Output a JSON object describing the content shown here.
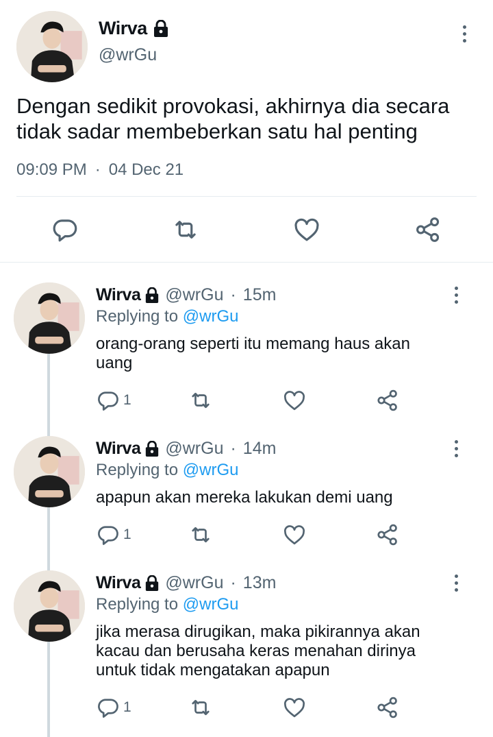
{
  "main_tweet": {
    "name": "Wirva",
    "handle": "@wrGu",
    "text_line1": "Dengan sedikit provokasi, akhirnya dia secara",
    "text_line2": "tidak sadar membeberkan satu hal penting",
    "time": "09:09 PM",
    "separator": "·",
    "date": "04 Dec 21"
  },
  "replies": [
    {
      "name": "Wirva",
      "handle": "@wrGu",
      "dot": "·",
      "time": "15m",
      "replying_prefix": "Replying to",
      "replying_handle": "@wrGu",
      "text_lines": [
        "orang-orang seperti itu memang haus akan",
        "uang"
      ],
      "reply_count": "1"
    },
    {
      "name": "Wirva",
      "handle": "@wrGu",
      "dot": "·",
      "time": "14m",
      "replying_prefix": "Replying to",
      "replying_handle": "@wrGu",
      "text_lines": [
        "apapun akan mereka lakukan demi uang"
      ],
      "reply_count": "1"
    },
    {
      "name": "Wirva",
      "handle": "@wrGu",
      "dot": "·",
      "time": "13m",
      "replying_prefix": "Replying to",
      "replying_handle": "@wrGu",
      "text_lines": [
        "jika merasa dirugikan, maka pikirannya akan",
        "kacau dan berusaha keras menahan dirinya",
        "untuk tidak mengatakan apapun"
      ],
      "reply_count": "1"
    }
  ],
  "colors": {
    "text": "#0f1419",
    "secondary": "#536471",
    "link": "#1d9bf0",
    "divider": "#e6ecf0",
    "thread_line": "#cfd9de"
  },
  "icons": [
    "lock-icon",
    "more-icon",
    "reply-icon",
    "retweet-icon",
    "like-icon",
    "share-icon"
  ]
}
